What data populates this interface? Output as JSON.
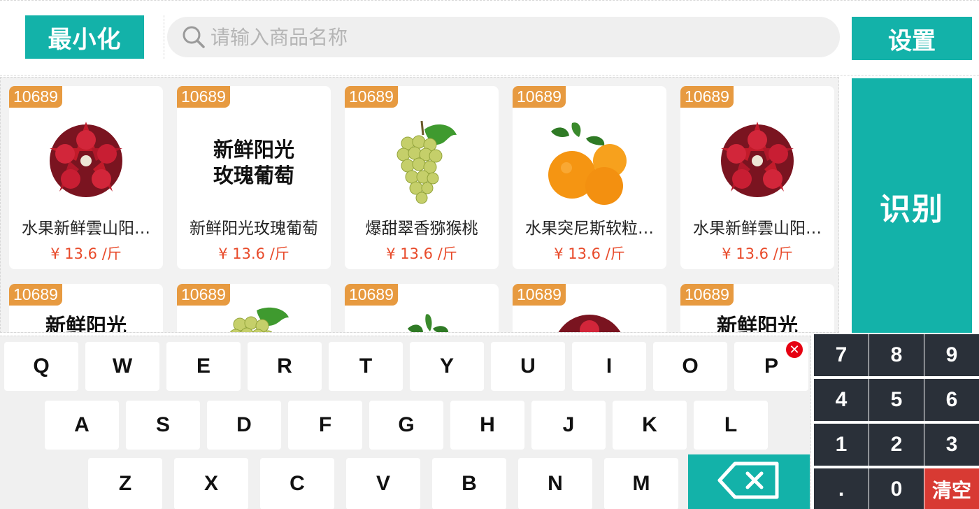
{
  "header": {
    "minimize_label": "最小化",
    "search_placeholder": "请输入商品名称",
    "settings_label": "设置"
  },
  "recognize_label": "识别",
  "products": [
    {
      "code": "10689",
      "image": "pomegranate",
      "name": "水果新鲜雲山阳…",
      "price": "¥ 13.6 /斤"
    },
    {
      "code": "10689",
      "image_text": "新鲜阳光\n玫瑰葡萄",
      "name": "新鲜阳光玫瑰葡萄",
      "price": "¥ 13.6 /斤"
    },
    {
      "code": "10689",
      "image": "green-grapes",
      "name": "爆甜翠香猕猴桃",
      "price": "¥ 13.6 /斤"
    },
    {
      "code": "10689",
      "image": "oranges",
      "name": "水果突尼斯软粒…",
      "price": "¥ 13.6 /斤"
    },
    {
      "code": "10689",
      "image": "pomegranate",
      "name": "水果新鲜雲山阳…",
      "price": "¥ 13.6 /斤"
    },
    {
      "code": "10689",
      "image_text": "新鲜阳光",
      "name": "",
      "price": ""
    },
    {
      "code": "10689",
      "image": "green-grapes",
      "name": "",
      "price": ""
    },
    {
      "code": "10689",
      "image": "oranges",
      "name": "",
      "price": ""
    },
    {
      "code": "10689",
      "image": "pomegranate",
      "name": "",
      "price": ""
    },
    {
      "code": "10689",
      "image_text": "新鲜阳光",
      "name": "",
      "price": ""
    }
  ],
  "keyboard": {
    "row1": [
      "Q",
      "W",
      "E",
      "R",
      "T",
      "Y",
      "U",
      "I",
      "O",
      "P"
    ],
    "row2": [
      "A",
      "S",
      "D",
      "F",
      "G",
      "H",
      "J",
      "K",
      "L"
    ],
    "row3": [
      "Z",
      "X",
      "C",
      "V",
      "B",
      "N",
      "M"
    ],
    "close_icon": "close-icon",
    "backspace_icon": "backspace-icon"
  },
  "numpad": {
    "keys": [
      "7",
      "8",
      "9",
      "4",
      "5",
      "6",
      "1",
      "2",
      "3",
      ".",
      "0",
      "清空"
    ]
  },
  "colors": {
    "accent": "#13b2a9",
    "badge": "#e79a40",
    "price": "#e84a2a",
    "numpad": "#2a3039",
    "clear": "#d83a33"
  }
}
